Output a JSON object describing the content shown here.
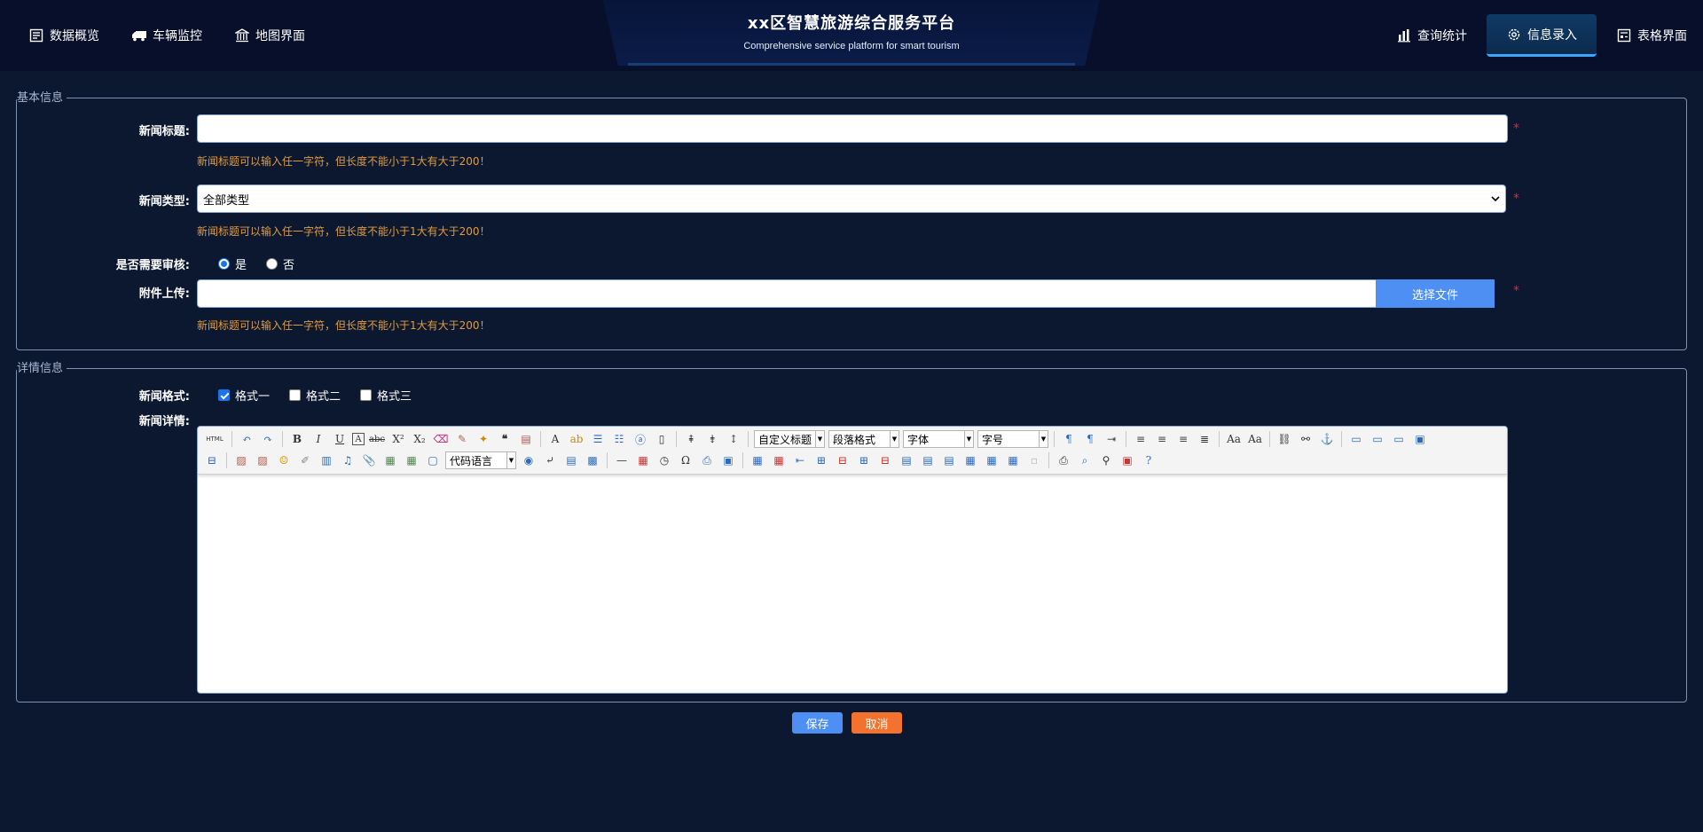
{
  "header": {
    "title": "xx区智慧旅游综合服务平台",
    "subtitle": "Comprehensive service platform for smart tourism",
    "nav_left": [
      {
        "label": "数据概览",
        "icon": "document-icon"
      },
      {
        "label": "车辆监控",
        "icon": "truck-icon"
      },
      {
        "label": "地图界面",
        "icon": "building-icon"
      }
    ],
    "nav_right": [
      {
        "label": "查询统计",
        "icon": "bar-chart-icon"
      },
      {
        "label": "信息录入",
        "icon": "gear-icon",
        "active": true
      },
      {
        "label": "表格界面",
        "icon": "table-icon"
      }
    ]
  },
  "basic": {
    "legend": "基本信息",
    "title_label": "新闻标题:",
    "title_value": "",
    "title_hint": "新闻标题可以输入任一字符，但长度不能小于1大有大于200！",
    "type_label": "新闻类型:",
    "type_value": "全部类型",
    "type_hint": "新闻标题可以输入任一字符，但长度不能小于1大有大于200！",
    "review_label": "是否需要审核:",
    "review_yes": "是",
    "review_no": "否",
    "review_selected": "是",
    "upload_label": "附件上传:",
    "upload_button": "选择文件",
    "upload_hint": "新闻标题可以输入任一字符，但长度不能小于1大有大于200！",
    "required_mark": "*"
  },
  "detail": {
    "legend": "详情信息",
    "format_label": "新闻格式:",
    "formats": [
      {
        "label": "格式一",
        "checked": true
      },
      {
        "label": "格式二",
        "checked": false
      },
      {
        "label": "格式三",
        "checked": false
      }
    ],
    "detail_label": "新闻详情:",
    "editor": {
      "combo_custom_title": "自定义标题",
      "combo_paragraph": "段落格式",
      "combo_font": "字体",
      "combo_size": "字号",
      "combo_code_lang": "代码语言",
      "html_label": "HTML"
    }
  },
  "actions": {
    "save": "保存",
    "cancel": "取消",
    "save_color": "#4d8ff2",
    "cancel_color": "#f2722e"
  },
  "colors": {
    "background": "#0b1830",
    "header": "#070f2a",
    "hint": "#e39b3a",
    "required": "#e02a2a",
    "accent": "#3aa6ff"
  }
}
